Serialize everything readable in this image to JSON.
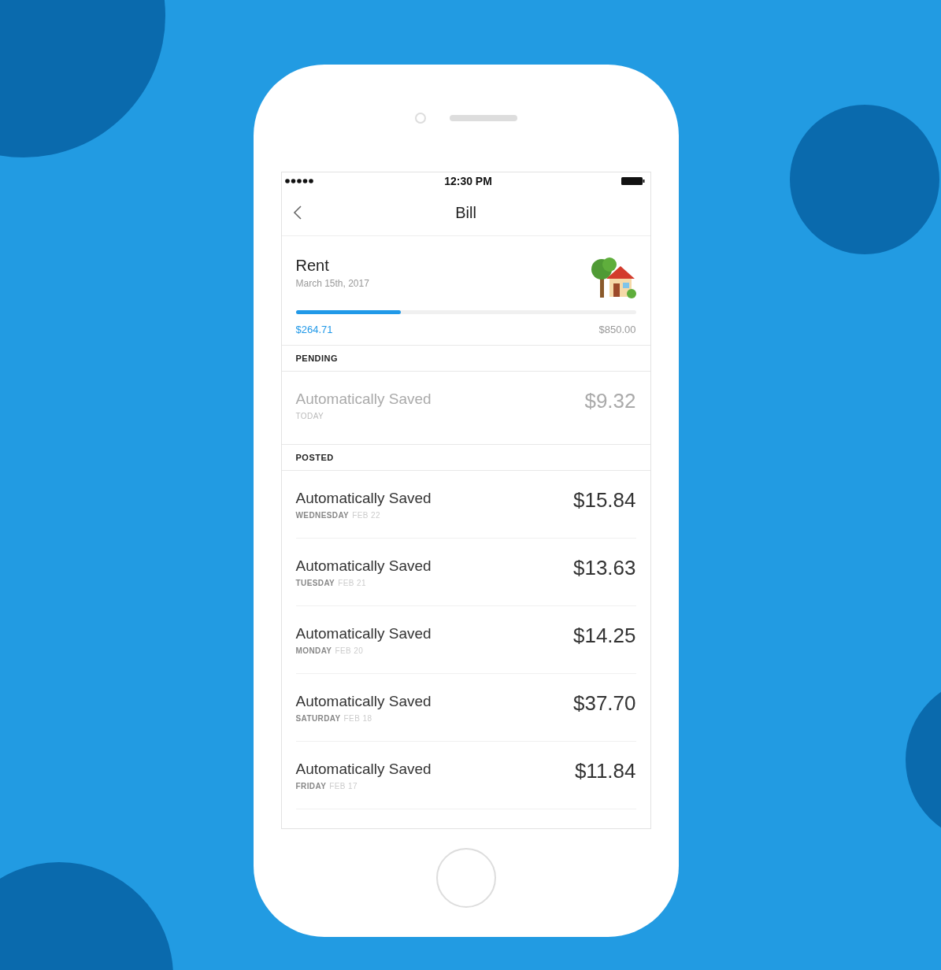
{
  "status_bar": {
    "time": "12:30 PM"
  },
  "nav": {
    "title": "Bill"
  },
  "bill": {
    "name": "Rent",
    "due_date": "March 15th, 2017",
    "level": 0.31,
    "saved": "$264.71",
    "total": "$850.00"
  },
  "sections": [
    {
      "title": "PENDING",
      "items": [
        {
          "label": "Automatically Saved",
          "day": "TODAY",
          "amount": "$9.32",
          "pending": true
        }
      ]
    },
    {
      "title": "POSTED",
      "items": [
        {
          "label": "Automatically Saved",
          "day": "WEDNESDAY",
          "date": "FEB 22",
          "amount": "$15.84",
          "pending": false
        },
        {
          "label": "Automatically Saved",
          "day": "TUESDAY",
          "date": "FEB 21",
          "amount": "$13.63",
          "pending": false
        },
        {
          "label": "Automatically Saved",
          "day": "MONDAY",
          "date": "FEB 20",
          "amount": "$14.25",
          "pending": false
        },
        {
          "label": "Automatically Saved",
          "day": "SATURDAY",
          "date": "FEB 18",
          "amount": "$37.70",
          "pending": false
        },
        {
          "label": "Automatically Saved",
          "day": "FRIDAY",
          "date": "FEB 17",
          "amount": "$11.84",
          "pending": false
        }
      ]
    }
  ]
}
